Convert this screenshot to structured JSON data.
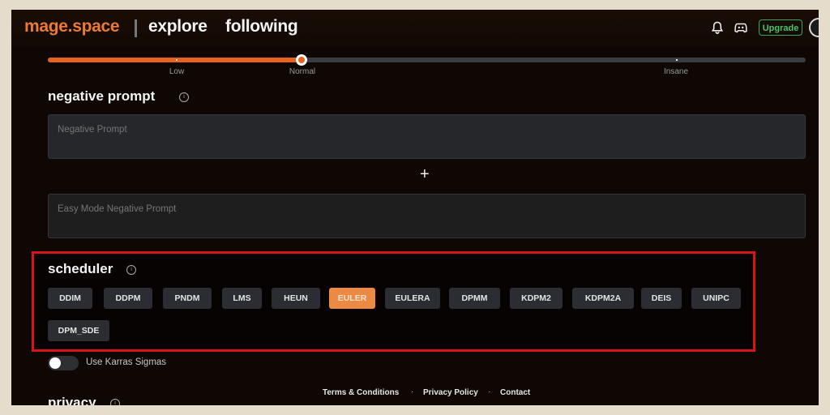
{
  "header": {
    "logo": "mage.space",
    "nav": [
      {
        "label": "explore"
      },
      {
        "label": "following"
      }
    ],
    "upgrade_label": "Upgrade",
    "icons": [
      "bell-icon",
      "discord-icon",
      "avatar"
    ]
  },
  "slider": {
    "value_label": "Normal",
    "value_fraction": 0.335,
    "labels": [
      {
        "text": "Low",
        "fraction": 0.17
      },
      {
        "text": "Normal",
        "fraction": 0.335
      },
      {
        "text": "Insane",
        "fraction": 0.83
      }
    ]
  },
  "negative_prompt": {
    "title": "negative prompt",
    "placeholder": "Negative Prompt",
    "add_label": "+",
    "easy_placeholder": "Easy Mode Negative Prompt"
  },
  "scheduler": {
    "title": "scheduler",
    "selected": "EULER",
    "options": [
      "DDIM",
      "DDPM",
      "PNDM",
      "LMS",
      "HEUN",
      "EULER",
      "EULERA",
      "DPMM",
      "KDPM2",
      "KDPM2A",
      "DEIS",
      "UNIPC",
      "DPM_SDE"
    ]
  },
  "karras": {
    "label": "Use Karras Sigmas",
    "enabled": false
  },
  "privacy": {
    "title": "privacy"
  },
  "footer": {
    "links": [
      "Terms & Conditions",
      "Privacy Policy",
      "Contact"
    ],
    "separator": "·"
  },
  "colors": {
    "accent": "#e5631f",
    "logo": "#ec7a34",
    "selected_button": "#ec8a43",
    "upgrade": "#49c46a",
    "highlight_box": "#d8141a"
  }
}
